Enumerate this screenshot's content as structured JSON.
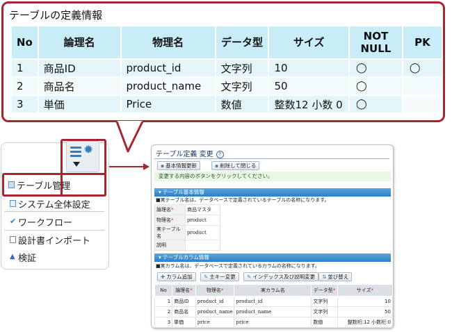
{
  "callout": {
    "title": "テーブルの定義情報",
    "headers": [
      "No",
      "論理名",
      "物理名",
      "データ型",
      "サイズ",
      "NOT\nNULL",
      "PK"
    ],
    "rows": [
      {
        "no": "1",
        "logical": "商品ID",
        "physical": "product_id",
        "type": "文字列",
        "size": "10",
        "not_null": "◯",
        "pk": "◯"
      },
      {
        "no": "2",
        "logical": "商品名",
        "physical": "product_name",
        "type": "文字列",
        "size": "50",
        "not_null": "◯",
        "pk": ""
      },
      {
        "no": "3",
        "logical": "単価",
        "physical": "Price",
        "type": "数値",
        "size": "整数12 小数 0",
        "not_null": "◯",
        "pk": ""
      }
    ]
  },
  "sidebar": {
    "items": [
      {
        "label": "テーブル管理",
        "icon": "table-icon"
      },
      {
        "label": "システム全体設定",
        "icon": "settings-icon"
      },
      {
        "label": "ワークフロー",
        "icon": "check-icon"
      },
      {
        "label": "設計書インポート",
        "icon": "document-icon"
      },
      {
        "label": "検証",
        "icon": "warning-icon"
      }
    ]
  },
  "screen": {
    "title": "テーブル定義 変更",
    "help_icon": "?",
    "buttons": {
      "basic_update": "基本情報更新",
      "delete_close": "削除して閉じる"
    },
    "notice": "変更する内容のボタンをクリックしてください。",
    "basic_section": {
      "title": "テーブル基本情報",
      "note": "■実テーブル名は、データベースで定義されているテーブルの名称になります。",
      "fields": [
        {
          "label": "論理名",
          "required": "*",
          "value": "商品マスタ"
        },
        {
          "label": "物理名",
          "required": "*",
          "value": "product"
        },
        {
          "label": "実テーブル名",
          "required": "",
          "value": "product"
        },
        {
          "label": "説明",
          "required": "",
          "value": ""
        }
      ]
    },
    "column_section": {
      "title": "テーブルカラム情報",
      "note": "■実カラム名は、データベースで定義されているカラムの名称になります。",
      "buttons": {
        "add_column": "カラム追加",
        "pk_change": "主キー変更",
        "index_change": "インデックス及び説明変更",
        "reorder": "並び替え"
      },
      "headers": [
        "No",
        "論理名",
        "物理名",
        "実カラム名",
        "データ型",
        "サイズ"
      ],
      "required_mark": "*",
      "rows": [
        {
          "no": "1",
          "logical": "商品ID",
          "physical": "product_id",
          "real": "product_id",
          "type": "文字列",
          "size": "10"
        },
        {
          "no": "2",
          "logical": "商品名",
          "physical": "product_name",
          "real": "product_name",
          "type": "文字列",
          "size": "50"
        },
        {
          "no": "3",
          "logical": "単価",
          "physical": "price",
          "real": "price",
          "type": "数値",
          "size": "整数桁:12 小数桁:0"
        }
      ]
    }
  },
  "colors": {
    "accent_red": "#a5262e",
    "header_blue": "#c8edf7",
    "section_blue": "#2f7ec2"
  }
}
